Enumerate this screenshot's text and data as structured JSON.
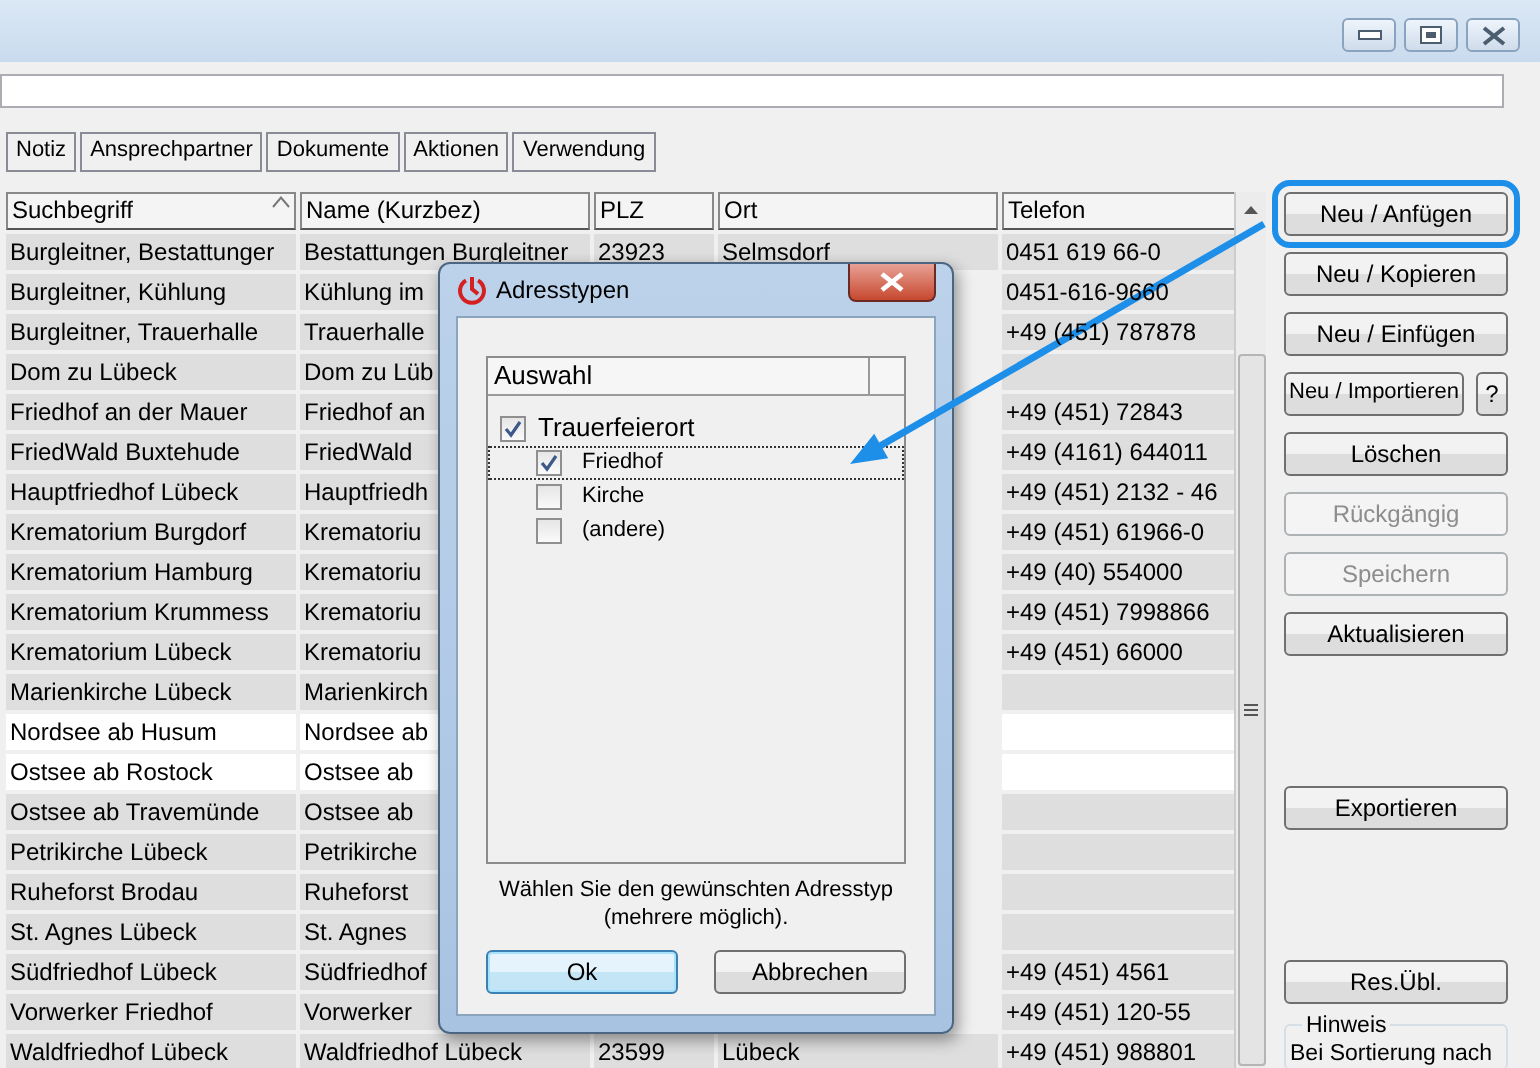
{
  "tabs": [
    {
      "label": "Notiz"
    },
    {
      "label": "Ansprechpartner"
    },
    {
      "label": "Dokumente"
    },
    {
      "label": "Aktionen"
    },
    {
      "label": "Verwendung"
    }
  ],
  "table": {
    "columns": [
      {
        "label": "Suchbegriff",
        "sorted": true
      },
      {
        "label": "Name (Kurzbez)",
        "sorted": false
      },
      {
        "label": "PLZ",
        "sorted": false
      },
      {
        "label": "Ort",
        "sorted": false
      },
      {
        "label": "Telefon",
        "sorted": false
      }
    ],
    "rows": [
      {
        "search_term": "Burgleitner, Bestattunger",
        "short_name": "Bestattungen Burgleitner",
        "postal_code": "23923",
        "city": "Selmsdorf",
        "phone": "0451  619 66-0",
        "highlighted": false
      },
      {
        "search_term": "Burgleitner, Kühlung",
        "short_name": "Kühlung im",
        "phone": "0451-616-9660",
        "highlighted": false
      },
      {
        "search_term": "Burgleitner, Trauerhalle",
        "short_name": "Trauerhalle",
        "phone": "+49 (451) 787878",
        "highlighted": false
      },
      {
        "search_term": "Dom zu Lübeck",
        "short_name": "Dom zu Lüb",
        "highlighted": false
      },
      {
        "search_term": "Friedhof an der Mauer",
        "short_name": "Friedhof an",
        "phone": "+49 (451) 72843",
        "highlighted": false
      },
      {
        "search_term": "FriedWald Buxtehude",
        "short_name": "FriedWald",
        "phone": "+49 (4161) 644011",
        "highlighted": false
      },
      {
        "search_term": "Hauptfriedhof Lübeck",
        "short_name": "Hauptfriedh",
        "phone": "+49 (451) 2132 - 46",
        "highlighted": false
      },
      {
        "search_term": "Krematorium Burgdorf",
        "short_name": "Krematoriu",
        "phone": "+49 (451) 61966-0",
        "highlighted": false
      },
      {
        "search_term": "Krematorium Hamburg",
        "short_name": "Krematoriu",
        "phone": "+49 (40) 554000",
        "highlighted": false
      },
      {
        "search_term": "Krematorium Krummess",
        "short_name": "Krematoriu",
        "phone": "+49 (451) 7998866",
        "highlighted": false
      },
      {
        "search_term": "Krematorium Lübeck",
        "short_name": "Krematoriu",
        "phone": "+49 (451) 66000",
        "highlighted": false
      },
      {
        "search_term": "Marienkirche Lübeck",
        "short_name": "Marienkirch",
        "highlighted": false
      },
      {
        "search_term": "Nordsee ab Husum",
        "short_name": "Nordsee ab",
        "highlighted": true
      },
      {
        "search_term": "Ostsee ab Rostock",
        "short_name": "Ostsee ab",
        "highlighted": true
      },
      {
        "search_term": "Ostsee ab Travemünde",
        "short_name": "Ostsee ab",
        "highlighted": false
      },
      {
        "search_term": "Petrikirche Lübeck",
        "short_name": "Petrikirche",
        "highlighted": false
      },
      {
        "search_term": "Ruheforst Brodau",
        "short_name": "Ruheforst",
        "highlighted": false
      },
      {
        "search_term": "St. Agnes Lübeck",
        "short_name": "St. Agnes",
        "highlighted": false
      },
      {
        "search_term": "Südfriedhof Lübeck",
        "short_name": "Südfriedhof",
        "phone": "+49 (451) 4561",
        "highlighted": false
      },
      {
        "search_term": "Vorwerker Friedhof",
        "short_name": "Vorwerker",
        "phone": "+49 (451) 120-55",
        "highlighted": false
      },
      {
        "search_term": "Waldfriedhof Lübeck",
        "short_name": "Waldfriedhof Lübeck",
        "postal_code": "23599",
        "city": "Lübeck",
        "phone": "+49 (451) 988801",
        "highlighted": false
      }
    ]
  },
  "button_groups": [
    [
      {
        "label": "Neu / Anfügen",
        "kind": "wide",
        "disabled": false,
        "highlighted": true
      },
      {
        "label": "Neu / Kopieren",
        "kind": "wide",
        "disabled": false,
        "highlighted": false
      },
      {
        "label": "Neu / Einfügen",
        "kind": "wide",
        "disabled": false,
        "highlighted": false
      },
      {
        "label": "Neu / Importieren",
        "kind": "medium",
        "disabled": false,
        "highlighted": false
      },
      {
        "label": "?",
        "kind": "small",
        "disabled": false,
        "highlighted": false
      },
      {
        "label": "Löschen",
        "kind": "wide",
        "disabled": false,
        "highlighted": false
      },
      {
        "label": "Rückgängig",
        "kind": "wide",
        "disabled": true,
        "highlighted": false
      },
      {
        "label": "Speichern",
        "kind": "wide",
        "disabled": true,
        "highlighted": false
      },
      {
        "label": "Aktualisieren",
        "kind": "wide",
        "disabled": false,
        "highlighted": false
      }
    ],
    [
      {
        "label": "Exportieren",
        "kind": "wide",
        "disabled": false,
        "highlighted": false
      }
    ],
    [
      {
        "label": "Res.Übl.",
        "kind": "wide",
        "disabled": false,
        "highlighted": false
      }
    ]
  ],
  "hint_box": {
    "title": "Hinweis",
    "text": "Bei Sortierung nach"
  },
  "dialog": {
    "title": "Adresstypen",
    "column_header": "Auswahl",
    "tree": [
      {
        "label": "Trauerfeierort",
        "checked": true,
        "focused": false,
        "children": [
          {
            "label": "Friedhof",
            "checked": true,
            "focused": true
          },
          {
            "label": "Kirche",
            "checked": false,
            "focused": false
          },
          {
            "label": "(andere)",
            "checked": false,
            "focused": false
          }
        ]
      }
    ],
    "hint": "Wählen Sie den gewünschten Adresstyp (mehrere möglich).",
    "buttons": [
      {
        "label": "Ok",
        "default": true
      },
      {
        "label": "Abbrechen",
        "default": false
      }
    ]
  }
}
